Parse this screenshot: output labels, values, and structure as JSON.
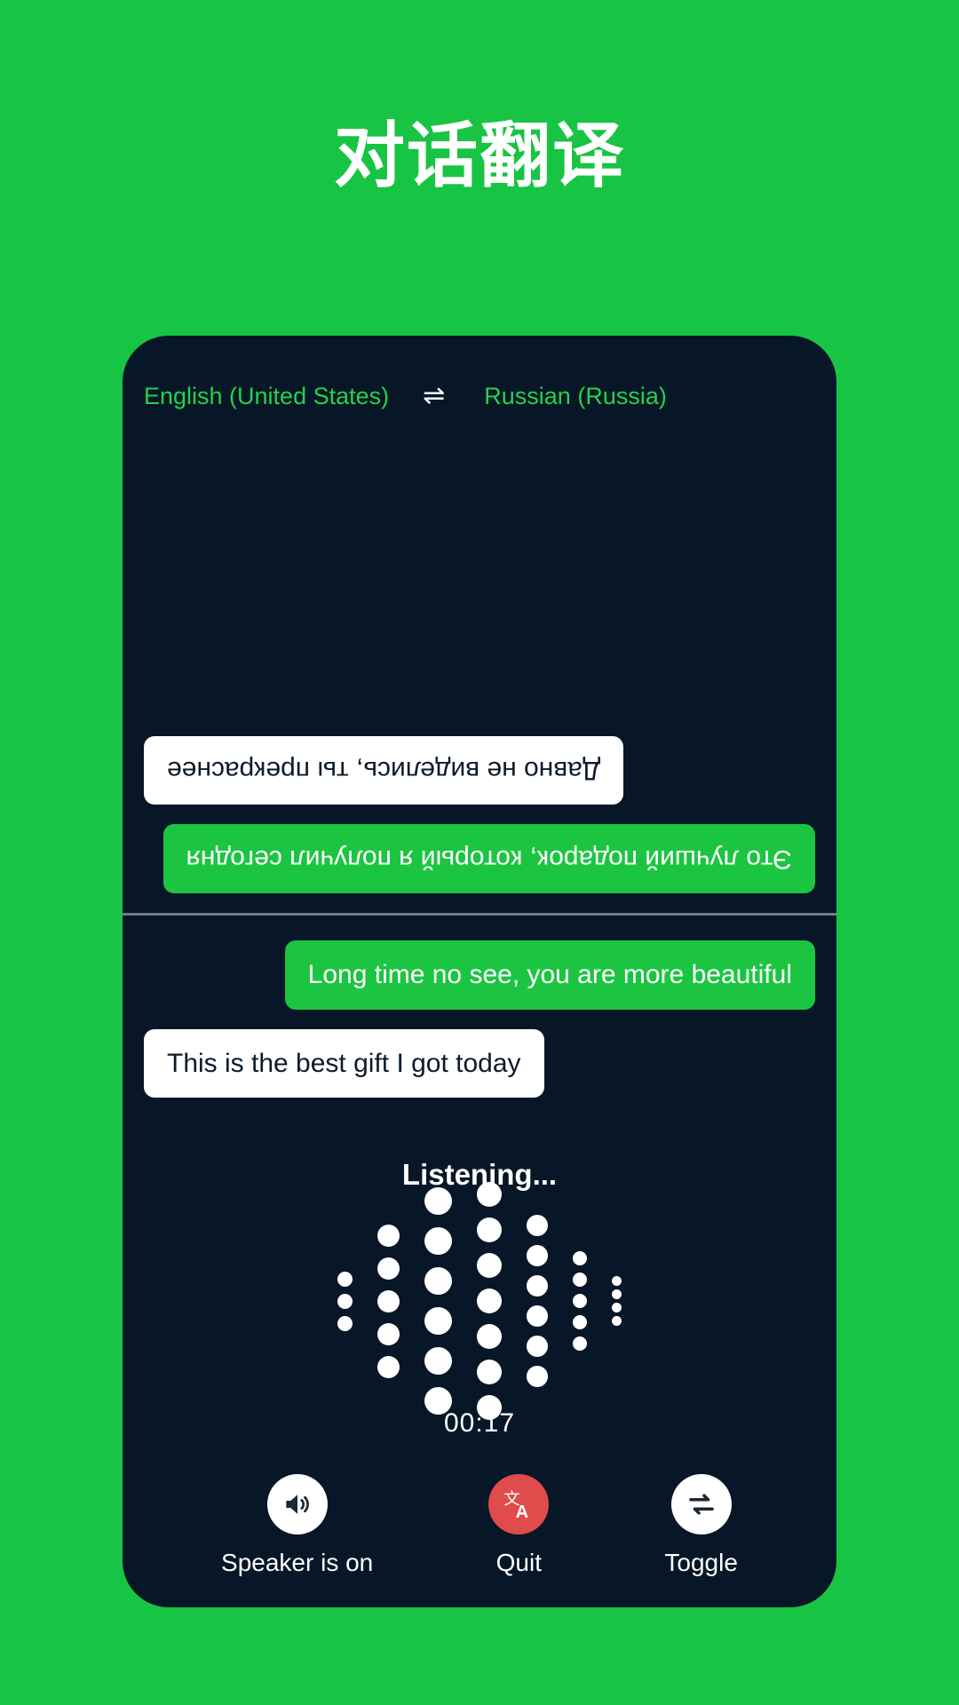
{
  "page": {
    "title": "对话翻译",
    "background_color": "#18C443"
  },
  "phone": {
    "background_color": "#071727",
    "languages": {
      "source": "English (United States)",
      "swap_icon": "⇌",
      "target": "Russian (Russia)",
      "accent_color": "#23D24B"
    },
    "conversation": {
      "top_pane_rotated": true,
      "top_messages": [
        {
          "text": "Это лучший подарок, который я получил сегодня",
          "style": "green",
          "align": "left"
        },
        {
          "text": "Давно не виделись, ты прекраснее",
          "style": "white",
          "align": "right"
        }
      ],
      "bottom_messages": [
        {
          "text": "Long time no see, you are more beautiful",
          "style": "green",
          "align": "right"
        },
        {
          "text": "This is the best gift I got today",
          "style": "white",
          "align": "left"
        }
      ]
    },
    "listening": {
      "status_label": "Listening...",
      "timer": "00:17",
      "waveform_columns": [
        {
          "dots": 3,
          "size": 17
        },
        {
          "dots": 5,
          "size": 25
        },
        {
          "dots": 6,
          "size": 31
        },
        {
          "dots": 7,
          "size": 28
        },
        {
          "dots": 6,
          "size": 24
        },
        {
          "dots": 5,
          "size": 16
        },
        {
          "dots": 4,
          "size": 11
        }
      ]
    },
    "controls": [
      {
        "label": "Speaker is on",
        "icon": "speaker-on-icon",
        "variant": "light"
      },
      {
        "label": "Quit",
        "icon": "translate-icon",
        "variant": "danger",
        "color": "#E04B4B"
      },
      {
        "label": "Toggle",
        "icon": "swap-arrows-icon",
        "variant": "light"
      }
    ]
  }
}
